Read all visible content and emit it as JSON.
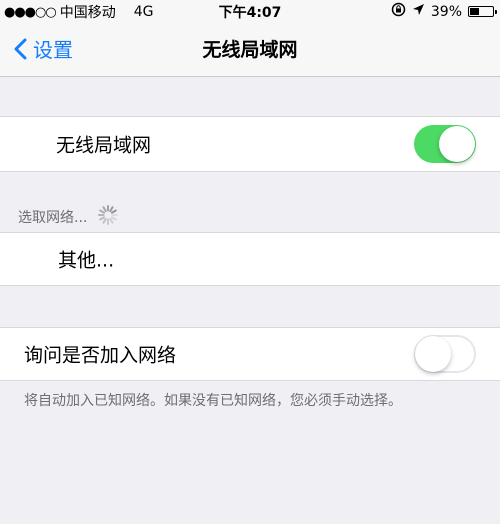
{
  "status_bar": {
    "signal": "●●●○○",
    "carrier": "中国移动",
    "network": "4G",
    "time": "下午4:07",
    "battery_text": "39%",
    "battery_level": 0.39
  },
  "nav": {
    "back_label": "设置",
    "title": "无线局域网"
  },
  "wifi_row": {
    "label": "无线局域网",
    "enabled": true
  },
  "networks": {
    "header": "选取网络...",
    "other_label": "其他..."
  },
  "ask_row": {
    "label": "询问是否加入网络",
    "enabled": false
  },
  "footer_note": "将自动加入已知网络。如果没有已知网络，您必须手动选择。",
  "colors": {
    "accent": "#157efb",
    "toggle_on": "#4cd964"
  },
  "icons": {
    "back": "chevron-left-icon",
    "orientation_lock": "rotation-lock-icon",
    "location": "location-arrow-icon",
    "spinner": "activity-spinner-icon"
  }
}
